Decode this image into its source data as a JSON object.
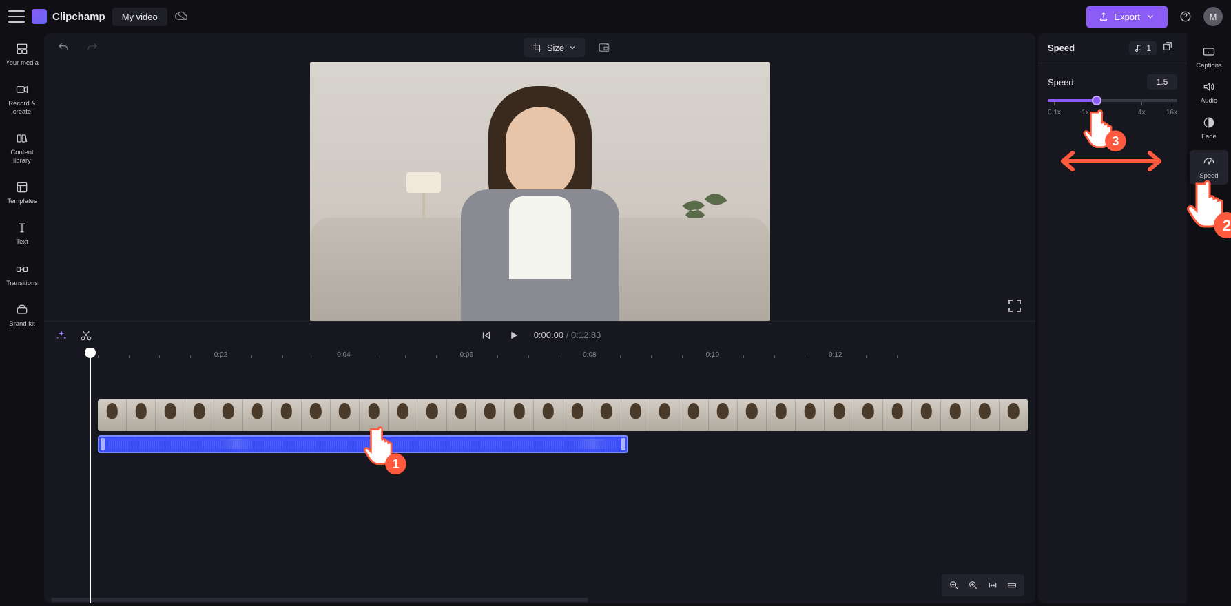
{
  "brand": "Clipchamp",
  "project_name": "My video",
  "export_label": "Export",
  "avatar_initial": "M",
  "left_rail": [
    {
      "label": "Your media"
    },
    {
      "label": "Record & create"
    },
    {
      "label": "Content library"
    },
    {
      "label": "Templates"
    },
    {
      "label": "Text"
    },
    {
      "label": "Transitions"
    },
    {
      "label": "Brand kit"
    }
  ],
  "preview": {
    "size_label": "Size"
  },
  "playback": {
    "current": "0:00.00",
    "separator": "/",
    "duration": "0:12.83"
  },
  "timeline": {
    "ticks": [
      "0:02",
      "0:04",
      "0:06",
      "0:08",
      "0:10",
      "0:12"
    ]
  },
  "right_panel": {
    "title": "Speed",
    "chip_count": "1",
    "section_label": "Speed",
    "value": "1.5",
    "tick_labels": [
      "0.1x",
      "1x",
      "4x",
      "16x"
    ]
  },
  "right_rail": [
    {
      "label": "Captions"
    },
    {
      "label": "Audio"
    },
    {
      "label": "Fade"
    },
    {
      "label": "Speed"
    }
  ],
  "pointers": {
    "p1": "1",
    "p2": "2",
    "p3": "3"
  }
}
